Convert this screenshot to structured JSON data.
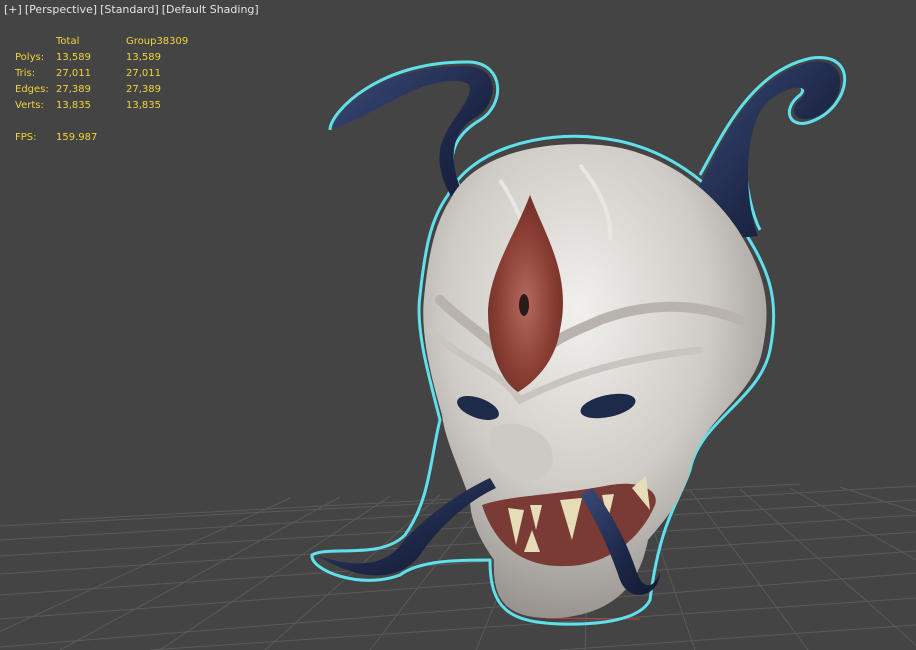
{
  "viewport_label": {
    "plus": "[+]",
    "view": "[Perspective]",
    "preset": "[Standard]",
    "shading": "[Default Shading]"
  },
  "stats": {
    "header": [
      "",
      "Total",
      "Group38309"
    ],
    "rows": [
      {
        "label": "Polys:",
        "total": "13,589",
        "group": "13,589"
      },
      {
        "label": "Tris:",
        "total": "27,011",
        "group": "27,011"
      },
      {
        "label": "Edges:",
        "total": "27,389",
        "group": "27,389"
      },
      {
        "label": "Verts:",
        "total": "13,835",
        "group": "13,835"
      }
    ],
    "fps_label": "FPS:",
    "fps_value": "159.987"
  },
  "colors": {
    "viewport_bg": "#444444",
    "stats_text": "#f2d43a",
    "label_text": "#e4e4e4",
    "selection_outline": "#5fe0ec",
    "grid_line": "#5a5a5a",
    "mask_bone": "#d9d6d2",
    "horn_blue": "#1e2a4a",
    "eye_red": "#9a4a3e"
  },
  "scene": {
    "object": "oni-mask-model",
    "selected": true
  }
}
